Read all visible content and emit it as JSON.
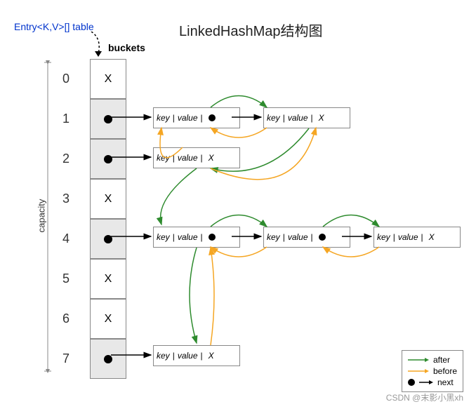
{
  "title": "LinkedHashMap结构图",
  "table_label": "Entry<K,V>[] table",
  "buckets_label": "buckets",
  "capacity_label": "capacity",
  "buckets": [
    {
      "index": "0",
      "type": "X",
      "shaded": false
    },
    {
      "index": "1",
      "type": "dot",
      "shaded": true
    },
    {
      "index": "2",
      "type": "dot",
      "shaded": true
    },
    {
      "index": "3",
      "type": "X",
      "shaded": false
    },
    {
      "index": "4",
      "type": "dot",
      "shaded": true
    },
    {
      "index": "5",
      "type": "X",
      "shaded": false
    },
    {
      "index": "6",
      "type": "X",
      "shaded": false
    },
    {
      "index": "7",
      "type": "dot",
      "shaded": true
    }
  ],
  "node_label_key": "key",
  "node_label_value": "value",
  "node_sep": " | ",
  "node_x": "X",
  "legend": {
    "after": "after",
    "before": "before",
    "next": "next"
  },
  "colors": {
    "after": "#2e8b2e",
    "before": "#f5a623",
    "next": "#000000"
  },
  "watermark": "CSDN @末影小黑xh",
  "chart_data": {
    "type": "diagram",
    "description": "LinkedHashMap internal structure: bucket array of size 8; buckets 1,2,4,7 have entry chains; entries have key|value|next pointer plus doubly-linked before/after pointers forming insertion-order list",
    "bucket_count": 8,
    "occupied_buckets": [
      1,
      2,
      4,
      7
    ],
    "chains": {
      "1": 2,
      "2": 1,
      "4": 3,
      "7": 1
    },
    "pointer_types": [
      "after (green)",
      "before (orange)",
      "next (black)"
    ]
  }
}
